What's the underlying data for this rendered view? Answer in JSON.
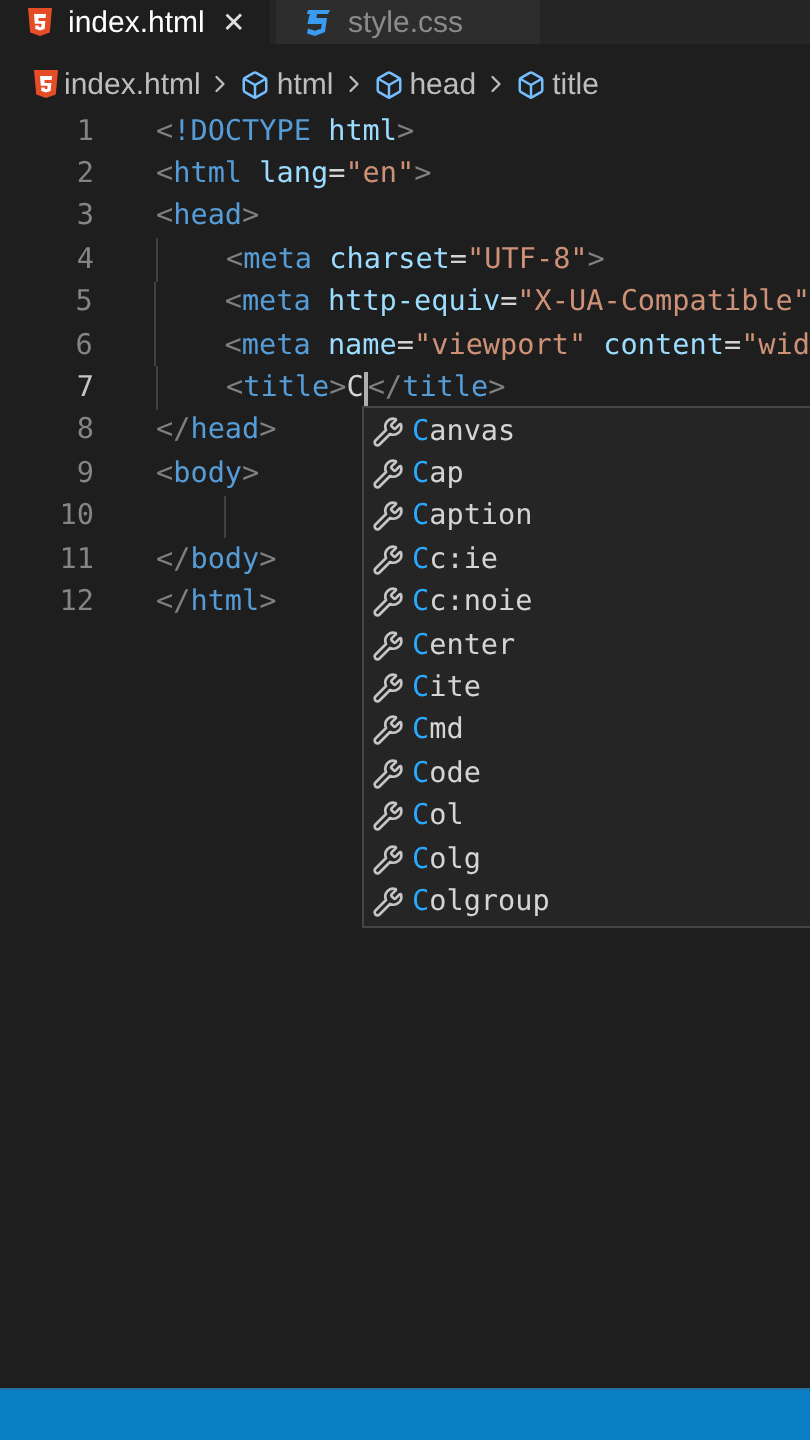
{
  "tabs": [
    {
      "label": "index.html",
      "kind": "html",
      "selected": true,
      "close": "✕"
    },
    {
      "label": "style.css",
      "kind": "css",
      "selected": false
    }
  ],
  "breadcrumb": [
    {
      "label": "index.html",
      "kind": "html"
    },
    {
      "label": "html",
      "kind": "element"
    },
    {
      "label": "head",
      "kind": "element"
    },
    {
      "label": "title",
      "kind": "element"
    }
  ],
  "editor": {
    "lines": [
      {
        "number": "1",
        "active": false,
        "indented": false,
        "guide": false,
        "tokens": [
          {
            "kind": "punct",
            "text": "<"
          },
          {
            "kind": "tag",
            "text": "!DOCTYPE"
          },
          {
            "kind": "attr",
            "text": " html"
          },
          {
            "kind": "punct",
            "text": ">"
          }
        ]
      },
      {
        "number": "2",
        "active": false,
        "indented": false,
        "guide": false,
        "tokens": [
          {
            "kind": "punct",
            "text": "<"
          },
          {
            "kind": "tag",
            "text": "html"
          },
          {
            "kind": "attr",
            "text": " lang"
          },
          {
            "kind": "text",
            "text": "="
          },
          {
            "kind": "str",
            "text": "\"en\""
          },
          {
            "kind": "punct",
            "text": ">"
          }
        ]
      },
      {
        "number": "3",
        "active": false,
        "indented": false,
        "guide": false,
        "tokens": [
          {
            "kind": "punct",
            "text": "<"
          },
          {
            "kind": "tag",
            "text": "head"
          },
          {
            "kind": "punct",
            "text": ">"
          }
        ]
      },
      {
        "number": "4",
        "active": false,
        "indented": true,
        "guide": true,
        "tokens": [
          {
            "kind": "punct",
            "text": "<"
          },
          {
            "kind": "tag",
            "text": "meta"
          },
          {
            "kind": "attr",
            "text": " charset"
          },
          {
            "kind": "text",
            "text": "="
          },
          {
            "kind": "str",
            "text": "\"UTF-8\""
          },
          {
            "kind": "punct",
            "text": ">"
          }
        ]
      },
      {
        "number": "5",
        "active": false,
        "indented": true,
        "guide": true,
        "tokens": [
          {
            "kind": "punct",
            "text": "<"
          },
          {
            "kind": "tag",
            "text": "meta"
          },
          {
            "kind": "attr",
            "text": " http-equiv"
          },
          {
            "kind": "text",
            "text": "="
          },
          {
            "kind": "str",
            "text": "\"X-UA-Compatible\""
          }
        ]
      },
      {
        "number": "6",
        "active": false,
        "indented": true,
        "guide": true,
        "tokens": [
          {
            "kind": "punct",
            "text": "<"
          },
          {
            "kind": "tag",
            "text": "meta"
          },
          {
            "kind": "attr",
            "text": " name"
          },
          {
            "kind": "text",
            "text": "="
          },
          {
            "kind": "str",
            "text": "\"viewport\""
          },
          {
            "kind": "attr",
            "text": " content"
          },
          {
            "kind": "text",
            "text": "="
          },
          {
            "kind": "str",
            "text": "\"wid"
          }
        ]
      },
      {
        "number": "7",
        "active": true,
        "indented": true,
        "guide": true,
        "tokens": [
          {
            "kind": "punct",
            "text": "<"
          },
          {
            "kind": "tag",
            "text": "title"
          },
          {
            "kind": "punct",
            "text": ">"
          },
          {
            "kind": "text",
            "text": "C"
          },
          {
            "kind": "cursor"
          },
          {
            "kind": "punct",
            "text": "</"
          },
          {
            "kind": "tag",
            "text": "title"
          },
          {
            "kind": "punct",
            "text": ">"
          }
        ]
      },
      {
        "number": "8",
        "active": false,
        "indented": false,
        "guide": false,
        "tokens": [
          {
            "kind": "punct",
            "text": "</"
          },
          {
            "kind": "tag",
            "text": "head"
          },
          {
            "kind": "punct",
            "text": ">"
          }
        ]
      },
      {
        "number": "9",
        "active": false,
        "indented": false,
        "guide": false,
        "tokens": [
          {
            "kind": "punct",
            "text": "<"
          },
          {
            "kind": "tag",
            "text": "body"
          },
          {
            "kind": "punct",
            "text": ">"
          }
        ]
      },
      {
        "number": "10",
        "active": false,
        "indented": true,
        "guide": true
      },
      {
        "number": "11",
        "active": false,
        "indented": false,
        "guide": false,
        "tokens": [
          {
            "kind": "punct",
            "text": "</"
          },
          {
            "kind": "tag",
            "text": "body"
          },
          {
            "kind": "punct",
            "text": ">"
          }
        ]
      },
      {
        "number": "12",
        "active": false,
        "indented": false,
        "guide": false,
        "tokens": [
          {
            "kind": "punct",
            "text": "</"
          },
          {
            "kind": "tag",
            "text": "html"
          },
          {
            "kind": "punct",
            "text": ">"
          }
        ]
      }
    ]
  },
  "suggestions": [
    {
      "match": "C",
      "rest": "anvas"
    },
    {
      "match": "C",
      "rest": "ap"
    },
    {
      "match": "C",
      "rest": "aption"
    },
    {
      "match": "C",
      "rest": "c:ie"
    },
    {
      "match": "C",
      "rest": "c:noie"
    },
    {
      "match": "C",
      "rest": "enter"
    },
    {
      "match": "C",
      "rest": "ite"
    },
    {
      "match": "C",
      "rest": "md"
    },
    {
      "match": "C",
      "rest": "ode"
    },
    {
      "match": "C",
      "rest": "ol"
    },
    {
      "match": "C",
      "rest": "olg"
    },
    {
      "match": "C",
      "rest": "olgroup"
    }
  ]
}
